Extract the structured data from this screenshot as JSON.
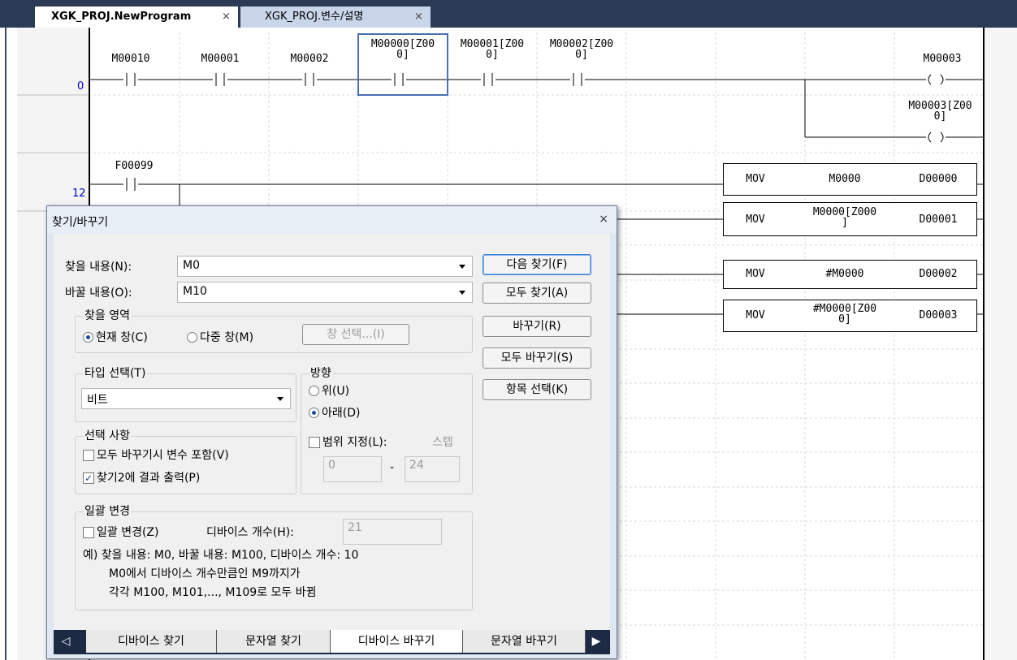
{
  "tabs": [
    {
      "label": "XGK_PROJ.NewProgram",
      "active": true
    },
    {
      "label": "XGK_PROJ.변수/설명",
      "active": false
    }
  ],
  "tab_close": "×",
  "ladder": {
    "steps": [
      "0",
      "12"
    ],
    "row0_contacts": [
      "M00010",
      "M00001",
      "M00002",
      "M00000[Z00\n0]",
      "M00001[Z00\n0]",
      "M00002[Z00\n0]"
    ],
    "row0_coils": [
      "M00003",
      "M00003[Z00\n0]"
    ],
    "row12_contact": "F00099",
    "mov_rows": [
      {
        "op": "MOV",
        "src": "M0000",
        "dst": "D00000"
      },
      {
        "op": "MOV",
        "src": "M0000[Z000\n]",
        "dst": "D00001"
      },
      {
        "op": "MOV",
        "src": "#M0000",
        "dst": "D00002"
      },
      {
        "op": "MOV",
        "src": "#M0000[Z00\n0]",
        "dst": "D00003"
      }
    ]
  },
  "dialog": {
    "title": "찾기/바꾸기",
    "close": "×",
    "find_label": "찾을 내용(N):",
    "find_value": "M0",
    "replace_label": "바꿀 내용(O):",
    "replace_value": "M10",
    "buttons": {
      "find_next": "다음 찾기(F)",
      "find_all": "모두 찾기(A)",
      "replace": "바꾸기(R)",
      "replace_all": "모두 바꾸기(S)",
      "select_items": "항목 선택(K)"
    },
    "scope": {
      "title": "찾을 영역",
      "current": "현재 창(C)",
      "multi": "다중 창(M)",
      "select_window": "창 선택...(I)"
    },
    "type": {
      "title": "타입 선택(T)",
      "value": "비트"
    },
    "direction": {
      "title": "방향",
      "up": "위(U)",
      "down": "아래(D)"
    },
    "range": {
      "label": "범위 지정(L):",
      "step": "스텝",
      "from": "0",
      "dash": "-",
      "to": "24"
    },
    "options": {
      "title": "선택 사항",
      "include_vars": "모두 바꾸기시 변수 포함(V)",
      "output_find2": "찾기2에 결과 출력(P)"
    },
    "batch": {
      "title": "일괄 변경",
      "check": "일괄 변경(Z)",
      "count_label": "디바이스 개수(H):",
      "count": "21",
      "note1": "예) 찾을 내용: M0, 바꿀 내용: M100, 디바이스 개수: 10",
      "note2": "M0에서 디바이스 개수만큼인 M9까지가",
      "note3": "각각 M100, M101,..., M109로 모두 바뀜"
    },
    "bottom_tabs": [
      "디바이스 찾기",
      "문자열 찾기",
      "디바이스 바꾸기",
      "문자열 바꾸기"
    ],
    "scroll_left": "◁",
    "scroll_right": "▶"
  }
}
